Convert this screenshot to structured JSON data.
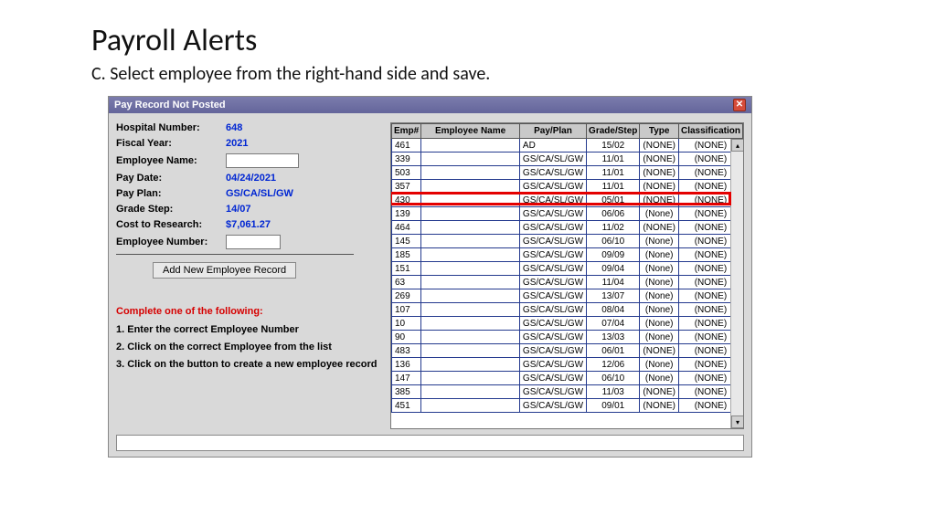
{
  "page": {
    "title": "Payroll Alerts",
    "subtitle": "C. Select employee from the right-hand side and save."
  },
  "window": {
    "title": "Pay Record Not Posted",
    "fields": {
      "hospital_number_label": "Hospital Number:",
      "hospital_number_value": "648",
      "fiscal_year_label": "Fiscal Year:",
      "fiscal_year_value": "2021",
      "employee_name_label": "Employee Name:",
      "pay_date_label": "Pay Date:",
      "pay_date_value": "04/24/2021",
      "pay_plan_label": "Pay Plan:",
      "pay_plan_value": "GS/CA/SL/GW",
      "grade_step_label": "Grade Step:",
      "grade_step_value": "14/07",
      "cost_label": "Cost to Research:",
      "cost_value": "$7,061.27",
      "employee_number_label": "Employee Number:"
    },
    "add_button": "Add New Employee Record",
    "complete_heading": "Complete one of the following:",
    "instructions": [
      "1. Enter the correct Employee Number",
      "2. Click on the correct Employee from the list",
      "3. Click on the button to create a new employee record"
    ],
    "columns": {
      "emp": "Emp#",
      "name": "Employee Name",
      "plan": "Pay/Plan",
      "grade": "Grade/Step",
      "type": "Type",
      "class": "Classification"
    },
    "highlighted_emp": "430",
    "rows": [
      {
        "emp": "461",
        "name": "",
        "plan": "AD",
        "grade": "15/02",
        "type": "(NONE)",
        "class": "(NONE)"
      },
      {
        "emp": "339",
        "name": "",
        "plan": "GS/CA/SL/GW",
        "grade": "11/01",
        "type": "(NONE)",
        "class": "(NONE)"
      },
      {
        "emp": "503",
        "name": "",
        "plan": "GS/CA/SL/GW",
        "grade": "11/01",
        "type": "(NONE)",
        "class": "(NONE)"
      },
      {
        "emp": "357",
        "name": "",
        "plan": "GS/CA/SL/GW",
        "grade": "11/01",
        "type": "(NONE)",
        "class": "(NONE)"
      },
      {
        "emp": "430",
        "name": "",
        "plan": "GS/CA/SL/GW",
        "grade": "05/01",
        "type": "(NONE)",
        "class": "(NONE)"
      },
      {
        "emp": "139",
        "name": "",
        "plan": "GS/CA/SL/GW",
        "grade": "06/06",
        "type": "(None)",
        "class": "(NONE)"
      },
      {
        "emp": "464",
        "name": "",
        "plan": "GS/CA/SL/GW",
        "grade": "11/02",
        "type": "(NONE)",
        "class": "(NONE)"
      },
      {
        "emp": "145",
        "name": "",
        "plan": "GS/CA/SL/GW",
        "grade": "06/10",
        "type": "(None)",
        "class": "(NONE)"
      },
      {
        "emp": "185",
        "name": "",
        "plan": "GS/CA/SL/GW",
        "grade": "09/09",
        "type": "(None)",
        "class": "(NONE)"
      },
      {
        "emp": "151",
        "name": "",
        "plan": "GS/CA/SL/GW",
        "grade": "09/04",
        "type": "(None)",
        "class": "(NONE)"
      },
      {
        "emp": "63",
        "name": "",
        "plan": "GS/CA/SL/GW",
        "grade": "11/04",
        "type": "(None)",
        "class": "(NONE)"
      },
      {
        "emp": "269",
        "name": "",
        "plan": "GS/CA/SL/GW",
        "grade": "13/07",
        "type": "(None)",
        "class": "(NONE)"
      },
      {
        "emp": "107",
        "name": "",
        "plan": "GS/CA/SL/GW",
        "grade": "08/04",
        "type": "(None)",
        "class": "(NONE)"
      },
      {
        "emp": "10",
        "name": "",
        "plan": "GS/CA/SL/GW",
        "grade": "07/04",
        "type": "(None)",
        "class": "(NONE)"
      },
      {
        "emp": "90",
        "name": "",
        "plan": "GS/CA/SL/GW",
        "grade": "13/03",
        "type": "(None)",
        "class": "(NONE)"
      },
      {
        "emp": "483",
        "name": "",
        "plan": "GS/CA/SL/GW",
        "grade": "06/01",
        "type": "(NONE)",
        "class": "(NONE)"
      },
      {
        "emp": "136",
        "name": "",
        "plan": "GS/CA/SL/GW",
        "grade": "12/06",
        "type": "(None)",
        "class": "(NONE)"
      },
      {
        "emp": "147",
        "name": "",
        "plan": "GS/CA/SL/GW",
        "grade": "06/10",
        "type": "(None)",
        "class": "(NONE)"
      },
      {
        "emp": "385",
        "name": "",
        "plan": "GS/CA/SL/GW",
        "grade": "11/03",
        "type": "(NONE)",
        "class": "(NONE)"
      },
      {
        "emp": "451",
        "name": "",
        "plan": "GS/CA/SL/GW",
        "grade": "09/01",
        "type": "(NONE)",
        "class": "(NONE)"
      }
    ]
  }
}
